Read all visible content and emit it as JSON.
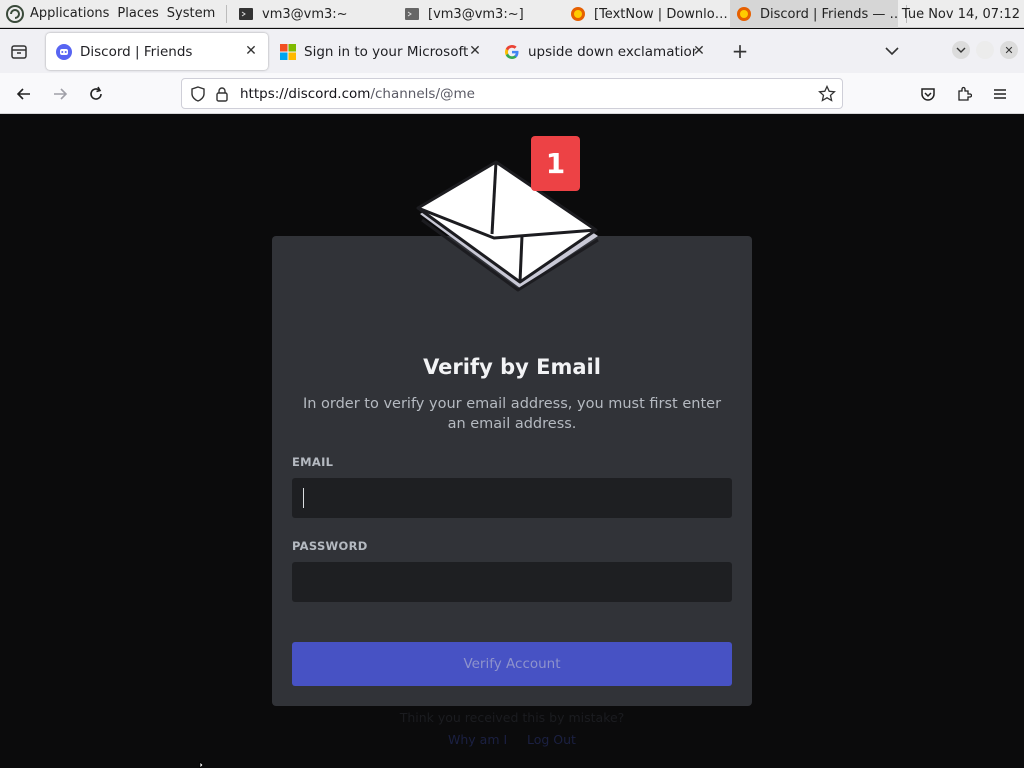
{
  "panel": {
    "menus": [
      "Applications",
      "Places",
      "System"
    ],
    "tasks": [
      {
        "label": "vm3@vm3:~",
        "icon": "terminal-icon"
      },
      {
        "label": "[vm3@vm3:~]",
        "icon": "terminal-icon"
      },
      {
        "label": "[TextNow | Downlo…",
        "icon": "firefox-icon"
      },
      {
        "label": "Discord | Friends — …",
        "icon": "firefox-icon"
      }
    ],
    "clock": "Tue Nov 14, 07:12"
  },
  "browser": {
    "tabs": [
      {
        "label": "Discord | Friends",
        "icon": "discord-icon",
        "selected": true
      },
      {
        "label": "Sign in to your Microsoft acc",
        "icon": "microsoft-icon"
      },
      {
        "label": "upside down exclamation po",
        "icon": "google-icon"
      }
    ],
    "url_host": "https://discord.com",
    "url_path": "/channels/@me"
  },
  "discord": {
    "badge": "1",
    "title": "Verify by Email",
    "subtitle": "In order to verify your email address, you must first enter an email address.",
    "email_label": "EMAIL",
    "email_value": "",
    "password_label": "PASSWORD",
    "password_value": "",
    "button_label": "Verify Account",
    "below_text": "Think you received this by mistake?",
    "links": [
      "Why am I",
      "Log Out"
    ]
  },
  "colors": {
    "blurple": "#4752c4",
    "card": "#313338",
    "input": "#1e1f22",
    "badge_red": "#ed4245"
  }
}
